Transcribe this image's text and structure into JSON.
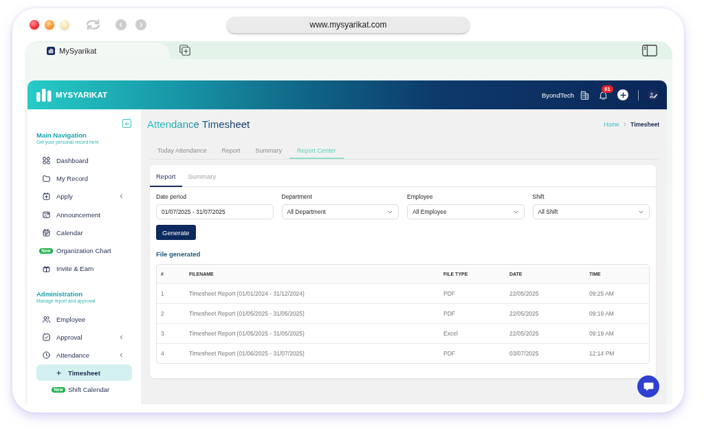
{
  "browser": {
    "url": "www.mysyarikat.com",
    "tab_title": "MySyarikat"
  },
  "header": {
    "brand": "MYSYARIKAT",
    "company": "ByondTech",
    "notification_count": "61"
  },
  "sidebar": {
    "sections": [
      {
        "title": "Main Navigation",
        "subtitle": "Get your personal record here",
        "items": [
          {
            "label": "Dashboard",
            "kind": "link",
            "selected": false
          },
          {
            "label": "My Record",
            "kind": "link",
            "selected": false
          },
          {
            "label": "Apply",
            "kind": "menu",
            "selected": false
          },
          {
            "label": "Announcement",
            "kind": "link",
            "selected": false
          },
          {
            "label": "Calendar",
            "kind": "link",
            "selected": false
          },
          {
            "label": "Organization Chart",
            "kind": "link",
            "badge": "New",
            "selected": false
          },
          {
            "label": "Invite & Earn",
            "kind": "link",
            "selected": false
          }
        ]
      },
      {
        "title": "Administration",
        "subtitle": "Manage report and approval",
        "items": [
          {
            "label": "Employee",
            "kind": "link",
            "selected": false
          },
          {
            "label": "Approval",
            "kind": "menu",
            "selected": false
          },
          {
            "label": "Attendance",
            "kind": "menu",
            "selected": false,
            "children": [
              {
                "label": "Timesheet",
                "selected": true
              },
              {
                "label": "Shift Calendar",
                "badge": "New",
                "selected": false
              }
            ]
          }
        ]
      }
    ]
  },
  "page": {
    "title": "Attendance Timesheet",
    "breadcrumb": [
      "Home",
      "Timesheet"
    ],
    "tabs": [
      {
        "label": "Today Attendance",
        "selected": false
      },
      {
        "label": "Report",
        "selected": false
      },
      {
        "label": "Summary",
        "selected": false
      },
      {
        "label": "Report Center",
        "selected": true
      }
    ]
  },
  "report_card": {
    "tabs": [
      {
        "label": "Report",
        "selected": true
      },
      {
        "label": "Summary",
        "selected": false
      }
    ],
    "fields": [
      {
        "kind": "date",
        "label": "Date period",
        "value": "01/07/2025 - 31/07/2025"
      },
      {
        "kind": "select",
        "label": "Department",
        "value": "All Department"
      },
      {
        "kind": "select",
        "label": "Employee",
        "value": "All Employee"
      },
      {
        "kind": "select",
        "label": "Shift",
        "value": "All Shift"
      }
    ],
    "button": "Generate",
    "files": {
      "title": "File generated",
      "columns": [
        "#",
        "FILENAME",
        "FILE TYPE",
        "DATE",
        "TIME"
      ],
      "rows": [
        [
          "1",
          "Timesheet Report (01/01/2024 - 31/12/2024)",
          "PDF",
          "22/05/2025",
          "09:25 AM"
        ],
        [
          "2",
          "Timesheet Report (01/05/2025 - 31/05/2025)",
          "PDF",
          "22/05/2025",
          "09:19 AM"
        ],
        [
          "3",
          "Timesheet Report (01/05/2025 - 31/05/2025)",
          "Excel",
          "22/05/2025",
          "09:19 AM"
        ],
        [
          "4",
          "Timesheet Report (01/06/2025 - 31/07/2025)",
          "PDF",
          "03/07/2025",
          "12:14 PM"
        ]
      ]
    }
  }
}
